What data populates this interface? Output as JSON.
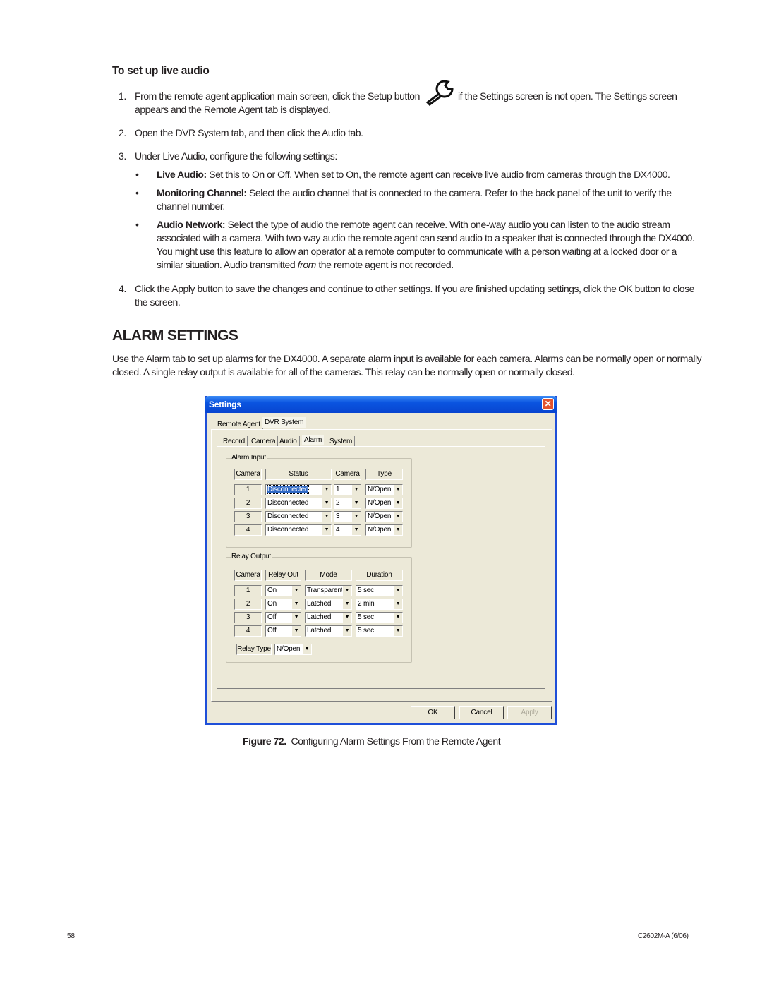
{
  "heading": "To set up live audio",
  "steps": [
    {
      "n": "1.",
      "a": "From the remote agent application main screen, click the Setup button",
      "b": "if the Settings screen is not open. The Settings screen",
      "c": "appears and the Remote Agent tab is displayed."
    },
    {
      "n": "2.",
      "a": "Open the DVR System tab, and then click the Audio tab."
    },
    {
      "n": "3.",
      "a": "Under Live Audio, configure the following settings:"
    },
    {
      "n": "4.",
      "a": "Click the Apply button to save the changes and continue to other settings. If you are finished updating settings, click the OK button to close",
      "c": "the screen."
    }
  ],
  "setup_icon": "wrench-icon",
  "bullets": [
    {
      "term": "Live Audio:",
      "lines": [
        " Set this to On or Off. When set to On, the remote agent can receive live audio from cameras through the DX4000."
      ]
    },
    {
      "term": "Monitoring Channel:",
      "lines": [
        " Select the audio channel that is connected to the camera. Refer to the back panel of the unit to verify the",
        "channel number."
      ]
    },
    {
      "term": "Audio Network:",
      "lines": [
        " Select the type of audio the remote agent can receive. With one-way audio you can listen to the audio stream",
        "associated with a camera. With two-way audio the remote agent can send audio to a speaker that is connected through the DX4000.",
        "You might use this feature to allow an operator at a remote computer to communicate with a person waiting at a locked door or a",
        "similar situation. Audio transmitted "
      ],
      "em": "from",
      "tail": " the remote agent is not recorded."
    }
  ],
  "section_title": "ALARM SETTINGS",
  "intro": [
    "Use the Alarm tab to set up alarms for the DX4000. A separate alarm input is available for each camera. Alarms can be normally open or normally",
    "closed. A single relay output is available for all of the cameras. This relay can be normally open or normally closed."
  ],
  "dialog": {
    "title": "Settings",
    "close": "✕",
    "tabs": [
      "Remote Agent",
      "DVR System"
    ],
    "subtabs": [
      "Record",
      "Camera",
      "Audio",
      "Alarm",
      "System"
    ],
    "alarm_input": {
      "label": "Alarm Input",
      "headers": [
        "Camera",
        "Status",
        "Camera",
        "Type"
      ],
      "rows": [
        [
          "1",
          "Disconnected",
          "1",
          "N/Open"
        ],
        [
          "2",
          "Disconnected",
          "2",
          "N/Open"
        ],
        [
          "3",
          "Disconnected",
          "3",
          "N/Open"
        ],
        [
          "4",
          "Disconnected",
          "4",
          "N/Open"
        ]
      ]
    },
    "relay_output": {
      "label": "Relay Output",
      "headers": [
        "Camera",
        "Relay Out",
        "Mode",
        "Duration"
      ],
      "rows": [
        [
          "1",
          "On",
          "Transparent",
          "5 sec"
        ],
        [
          "2",
          "On",
          "Latched",
          "2 min"
        ],
        [
          "3",
          "Off",
          "Latched",
          "5 sec"
        ],
        [
          "4",
          "Off",
          "Latched",
          "5 sec"
        ]
      ],
      "relay_type_label": "Relay Type",
      "relay_type": "N/Open"
    },
    "buttons": {
      "ok": "OK",
      "cancel": "Cancel",
      "apply": "Apply"
    }
  },
  "caption": {
    "label": "Figure 72.",
    "text": "Configuring Alarm Settings From the Remote Agent"
  },
  "footer": {
    "page": "58",
    "doc": "C2602M-A (6/06)"
  }
}
